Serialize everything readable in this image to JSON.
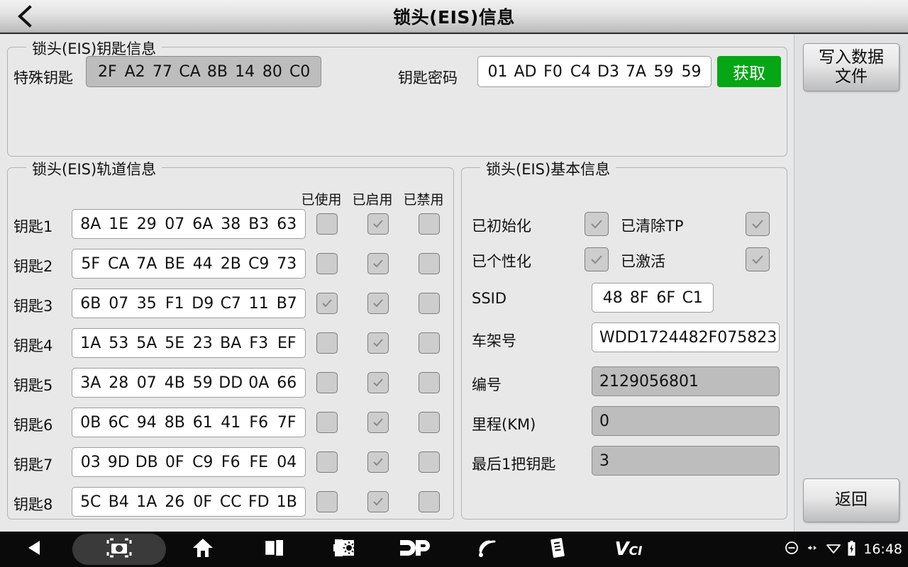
{
  "titlebar": {
    "back_icon": "chevron-left-icon",
    "title": "锁头(EIS)信息"
  },
  "key_info": {
    "group_title": "锁头(EIS)钥匙信息",
    "special_key_label": "特殊钥匙",
    "special_key_value": [
      "2F",
      "A2",
      "77",
      "CA",
      "8B",
      "14",
      "80",
      "C0"
    ],
    "key_password_label": "钥匙密码",
    "key_password_value": [
      "01",
      "AD",
      "F0",
      "C4",
      "D3",
      "7A",
      "59",
      "59"
    ],
    "get_button_label": "获取",
    "get_button_color": "#06a616"
  },
  "track_info": {
    "group_title": "锁头(EIS)轨道信息",
    "columns": [
      "已使用",
      "已启用",
      "已禁用"
    ],
    "rows": [
      {
        "label": "钥匙1",
        "value": [
          "8A",
          "1E",
          "29",
          "07",
          "6A",
          "38",
          "B3",
          "63"
        ],
        "used": false,
        "enabled": true,
        "disabled": false
      },
      {
        "label": "钥匙2",
        "value": [
          "5F",
          "CA",
          "7A",
          "BE",
          "44",
          "2B",
          "C9",
          "73"
        ],
        "used": false,
        "enabled": true,
        "disabled": false
      },
      {
        "label": "钥匙3",
        "value": [
          "6B",
          "07",
          "35",
          "F1",
          "D9",
          "C7",
          "11",
          "B7"
        ],
        "used": true,
        "enabled": true,
        "disabled": false
      },
      {
        "label": "钥匙4",
        "value": [
          "1A",
          "53",
          "5A",
          "5E",
          "23",
          "BA",
          "F3",
          "EF"
        ],
        "used": false,
        "enabled": true,
        "disabled": false
      },
      {
        "label": "钥匙5",
        "value": [
          "3A",
          "28",
          "07",
          "4B",
          "59",
          "DD",
          "0A",
          "66"
        ],
        "used": false,
        "enabled": true,
        "disabled": false
      },
      {
        "label": "钥匙6",
        "value": [
          "0B",
          "6C",
          "94",
          "8B",
          "61",
          "41",
          "F6",
          "7F"
        ],
        "used": false,
        "enabled": true,
        "disabled": false
      },
      {
        "label": "钥匙7",
        "value": [
          "03",
          "9D",
          "DB",
          "0F",
          "C9",
          "F6",
          "FE",
          "04"
        ],
        "used": false,
        "enabled": true,
        "disabled": false
      },
      {
        "label": "钥匙8",
        "value": [
          "5C",
          "B4",
          "1A",
          "26",
          "0F",
          "CC",
          "FD",
          "1B"
        ],
        "used": false,
        "enabled": true,
        "disabled": false
      }
    ]
  },
  "basic_info": {
    "group_title": "锁头(EIS)基本信息",
    "initialized_label": "已初始化",
    "initialized_checked": true,
    "tp_cleared_label": "已清除TP",
    "tp_cleared_checked": true,
    "personalized_label": "已个性化",
    "personalized_checked": true,
    "activated_label": "已激活",
    "activated_checked": true,
    "ssid_label": "SSID",
    "ssid_value": [
      "48",
      "8F",
      "6F",
      "C1"
    ],
    "vin_label": "车架号",
    "vin_value": "WDD1724482F075823",
    "number_label": "编号",
    "number_value": "2129056801",
    "mileage_label": "里程(KM)",
    "mileage_value": "0",
    "last_key_label": "最后1把钥匙",
    "last_key_value": "3"
  },
  "sidebar": {
    "write_button_line1": "写入数据",
    "write_button_line2": "文件",
    "back_button_label": "返回"
  },
  "navbar": {
    "items": [
      {
        "name": "back-nav-icon",
        "icon": "triangle-left-icon"
      },
      {
        "name": "screenshot-nav-icon",
        "icon": "camera-icon"
      },
      {
        "name": "home-nav-icon",
        "icon": "home-icon"
      },
      {
        "name": "recents-nav-icon",
        "icon": "square-stack-icon"
      },
      {
        "name": "volume-nav-icon",
        "icon": "speaker-brightness-icon"
      },
      {
        "name": "dp-app-icon",
        "icon": "dp-logo-icon"
      },
      {
        "name": "wireless-nav-icon",
        "icon": "signal-waves-icon"
      },
      {
        "name": "manual-nav-icon",
        "icon": "book-icon"
      },
      {
        "name": "vci-app-icon",
        "icon": "vci-logo-icon"
      }
    ],
    "status_icons": [
      "do-not-disturb-icon",
      "usb-icon",
      "wifi-icon",
      "battery-icon"
    ],
    "time": "16:48"
  }
}
